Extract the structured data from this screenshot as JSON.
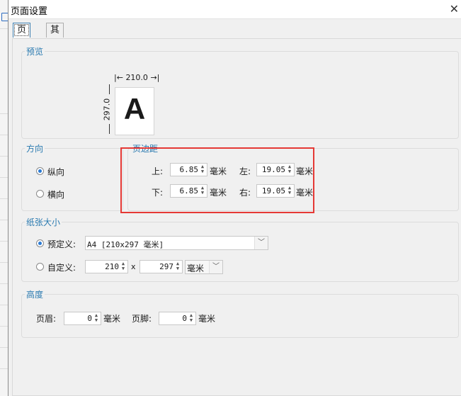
{
  "dialog": {
    "title": "页面设置"
  },
  "tabs": [
    {
      "label": "页面",
      "active": true
    },
    {
      "label": "其他",
      "active": false
    }
  ],
  "preview": {
    "group_title": "预览",
    "width_label": "210.0",
    "height_label": "297.0",
    "letter": "A"
  },
  "orientation": {
    "group_title": "方向",
    "portrait_label": "纵向",
    "landscape_label": "横向",
    "selected": "portrait"
  },
  "margins": {
    "group_title": "页边距",
    "top_label": "上:",
    "top_value": "6.85",
    "left_label": "左:",
    "left_value": "19.05",
    "bottom_label": "下:",
    "bottom_value": "6.85",
    "right_label": "右:",
    "right_value": "19.05",
    "unit": "毫米"
  },
  "paper": {
    "group_title": "纸张大小",
    "preset_label": "预定义:",
    "preset_value": "A4 [210x297 毫米]",
    "custom_label": "自定义:",
    "custom_width": "210",
    "times": "x",
    "custom_height": "297",
    "custom_unit": "毫米",
    "selected": "preset"
  },
  "height": {
    "group_title": "高度",
    "header_label": "页眉:",
    "header_value": "0",
    "footer_label": "页脚:",
    "footer_value": "0",
    "unit": "毫米"
  },
  "colors": {
    "accent": "#2a7ab0",
    "highlight": "#e53935"
  }
}
